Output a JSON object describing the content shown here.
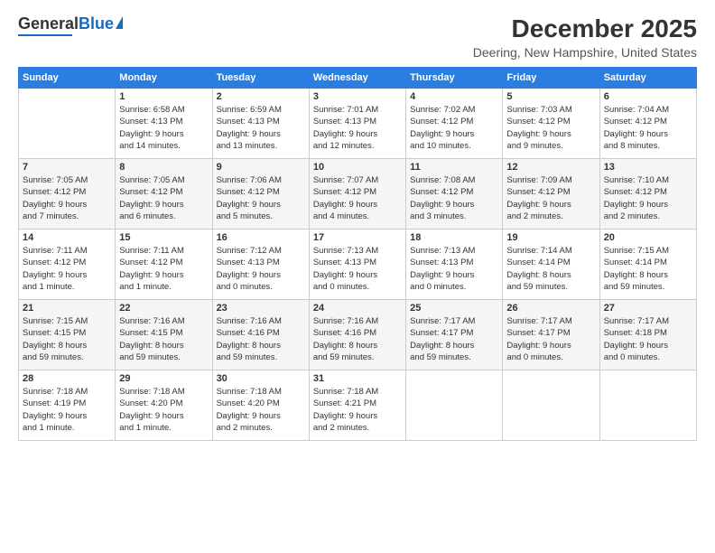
{
  "header": {
    "logo": {
      "general": "General",
      "blue": "Blue"
    },
    "title": "December 2025",
    "subtitle": "Deering, New Hampshire, United States"
  },
  "calendar": {
    "days_of_week": [
      "Sunday",
      "Monday",
      "Tuesday",
      "Wednesday",
      "Thursday",
      "Friday",
      "Saturday"
    ],
    "weeks": [
      [
        {
          "day": "",
          "info": ""
        },
        {
          "day": "1",
          "info": "Sunrise: 6:58 AM\nSunset: 4:13 PM\nDaylight: 9 hours\nand 14 minutes."
        },
        {
          "day": "2",
          "info": "Sunrise: 6:59 AM\nSunset: 4:13 PM\nDaylight: 9 hours\nand 13 minutes."
        },
        {
          "day": "3",
          "info": "Sunrise: 7:01 AM\nSunset: 4:13 PM\nDaylight: 9 hours\nand 12 minutes."
        },
        {
          "day": "4",
          "info": "Sunrise: 7:02 AM\nSunset: 4:12 PM\nDaylight: 9 hours\nand 10 minutes."
        },
        {
          "day": "5",
          "info": "Sunrise: 7:03 AM\nSunset: 4:12 PM\nDaylight: 9 hours\nand 9 minutes."
        },
        {
          "day": "6",
          "info": "Sunrise: 7:04 AM\nSunset: 4:12 PM\nDaylight: 9 hours\nand 8 minutes."
        }
      ],
      [
        {
          "day": "7",
          "info": "Sunrise: 7:05 AM\nSunset: 4:12 PM\nDaylight: 9 hours\nand 7 minutes."
        },
        {
          "day": "8",
          "info": "Sunrise: 7:05 AM\nSunset: 4:12 PM\nDaylight: 9 hours\nand 6 minutes."
        },
        {
          "day": "9",
          "info": "Sunrise: 7:06 AM\nSunset: 4:12 PM\nDaylight: 9 hours\nand 5 minutes."
        },
        {
          "day": "10",
          "info": "Sunrise: 7:07 AM\nSunset: 4:12 PM\nDaylight: 9 hours\nand 4 minutes."
        },
        {
          "day": "11",
          "info": "Sunrise: 7:08 AM\nSunset: 4:12 PM\nDaylight: 9 hours\nand 3 minutes."
        },
        {
          "day": "12",
          "info": "Sunrise: 7:09 AM\nSunset: 4:12 PM\nDaylight: 9 hours\nand 2 minutes."
        },
        {
          "day": "13",
          "info": "Sunrise: 7:10 AM\nSunset: 4:12 PM\nDaylight: 9 hours\nand 2 minutes."
        }
      ],
      [
        {
          "day": "14",
          "info": "Sunrise: 7:11 AM\nSunset: 4:12 PM\nDaylight: 9 hours\nand 1 minute."
        },
        {
          "day": "15",
          "info": "Sunrise: 7:11 AM\nSunset: 4:12 PM\nDaylight: 9 hours\nand 1 minute."
        },
        {
          "day": "16",
          "info": "Sunrise: 7:12 AM\nSunset: 4:13 PM\nDaylight: 9 hours\nand 0 minutes."
        },
        {
          "day": "17",
          "info": "Sunrise: 7:13 AM\nSunset: 4:13 PM\nDaylight: 9 hours\nand 0 minutes."
        },
        {
          "day": "18",
          "info": "Sunrise: 7:13 AM\nSunset: 4:13 PM\nDaylight: 9 hours\nand 0 minutes."
        },
        {
          "day": "19",
          "info": "Sunrise: 7:14 AM\nSunset: 4:14 PM\nDaylight: 8 hours\nand 59 minutes."
        },
        {
          "day": "20",
          "info": "Sunrise: 7:15 AM\nSunset: 4:14 PM\nDaylight: 8 hours\nand 59 minutes."
        }
      ],
      [
        {
          "day": "21",
          "info": "Sunrise: 7:15 AM\nSunset: 4:15 PM\nDaylight: 8 hours\nand 59 minutes."
        },
        {
          "day": "22",
          "info": "Sunrise: 7:16 AM\nSunset: 4:15 PM\nDaylight: 8 hours\nand 59 minutes."
        },
        {
          "day": "23",
          "info": "Sunrise: 7:16 AM\nSunset: 4:16 PM\nDaylight: 8 hours\nand 59 minutes."
        },
        {
          "day": "24",
          "info": "Sunrise: 7:16 AM\nSunset: 4:16 PM\nDaylight: 8 hours\nand 59 minutes."
        },
        {
          "day": "25",
          "info": "Sunrise: 7:17 AM\nSunset: 4:17 PM\nDaylight: 8 hours\nand 59 minutes."
        },
        {
          "day": "26",
          "info": "Sunrise: 7:17 AM\nSunset: 4:17 PM\nDaylight: 9 hours\nand 0 minutes."
        },
        {
          "day": "27",
          "info": "Sunrise: 7:17 AM\nSunset: 4:18 PM\nDaylight: 9 hours\nand 0 minutes."
        }
      ],
      [
        {
          "day": "28",
          "info": "Sunrise: 7:18 AM\nSunset: 4:19 PM\nDaylight: 9 hours\nand 1 minute."
        },
        {
          "day": "29",
          "info": "Sunrise: 7:18 AM\nSunset: 4:20 PM\nDaylight: 9 hours\nand 1 minute."
        },
        {
          "day": "30",
          "info": "Sunrise: 7:18 AM\nSunset: 4:20 PM\nDaylight: 9 hours\nand 2 minutes."
        },
        {
          "day": "31",
          "info": "Sunrise: 7:18 AM\nSunset: 4:21 PM\nDaylight: 9 hours\nand 2 minutes."
        },
        {
          "day": "",
          "info": ""
        },
        {
          "day": "",
          "info": ""
        },
        {
          "day": "",
          "info": ""
        }
      ]
    ]
  }
}
